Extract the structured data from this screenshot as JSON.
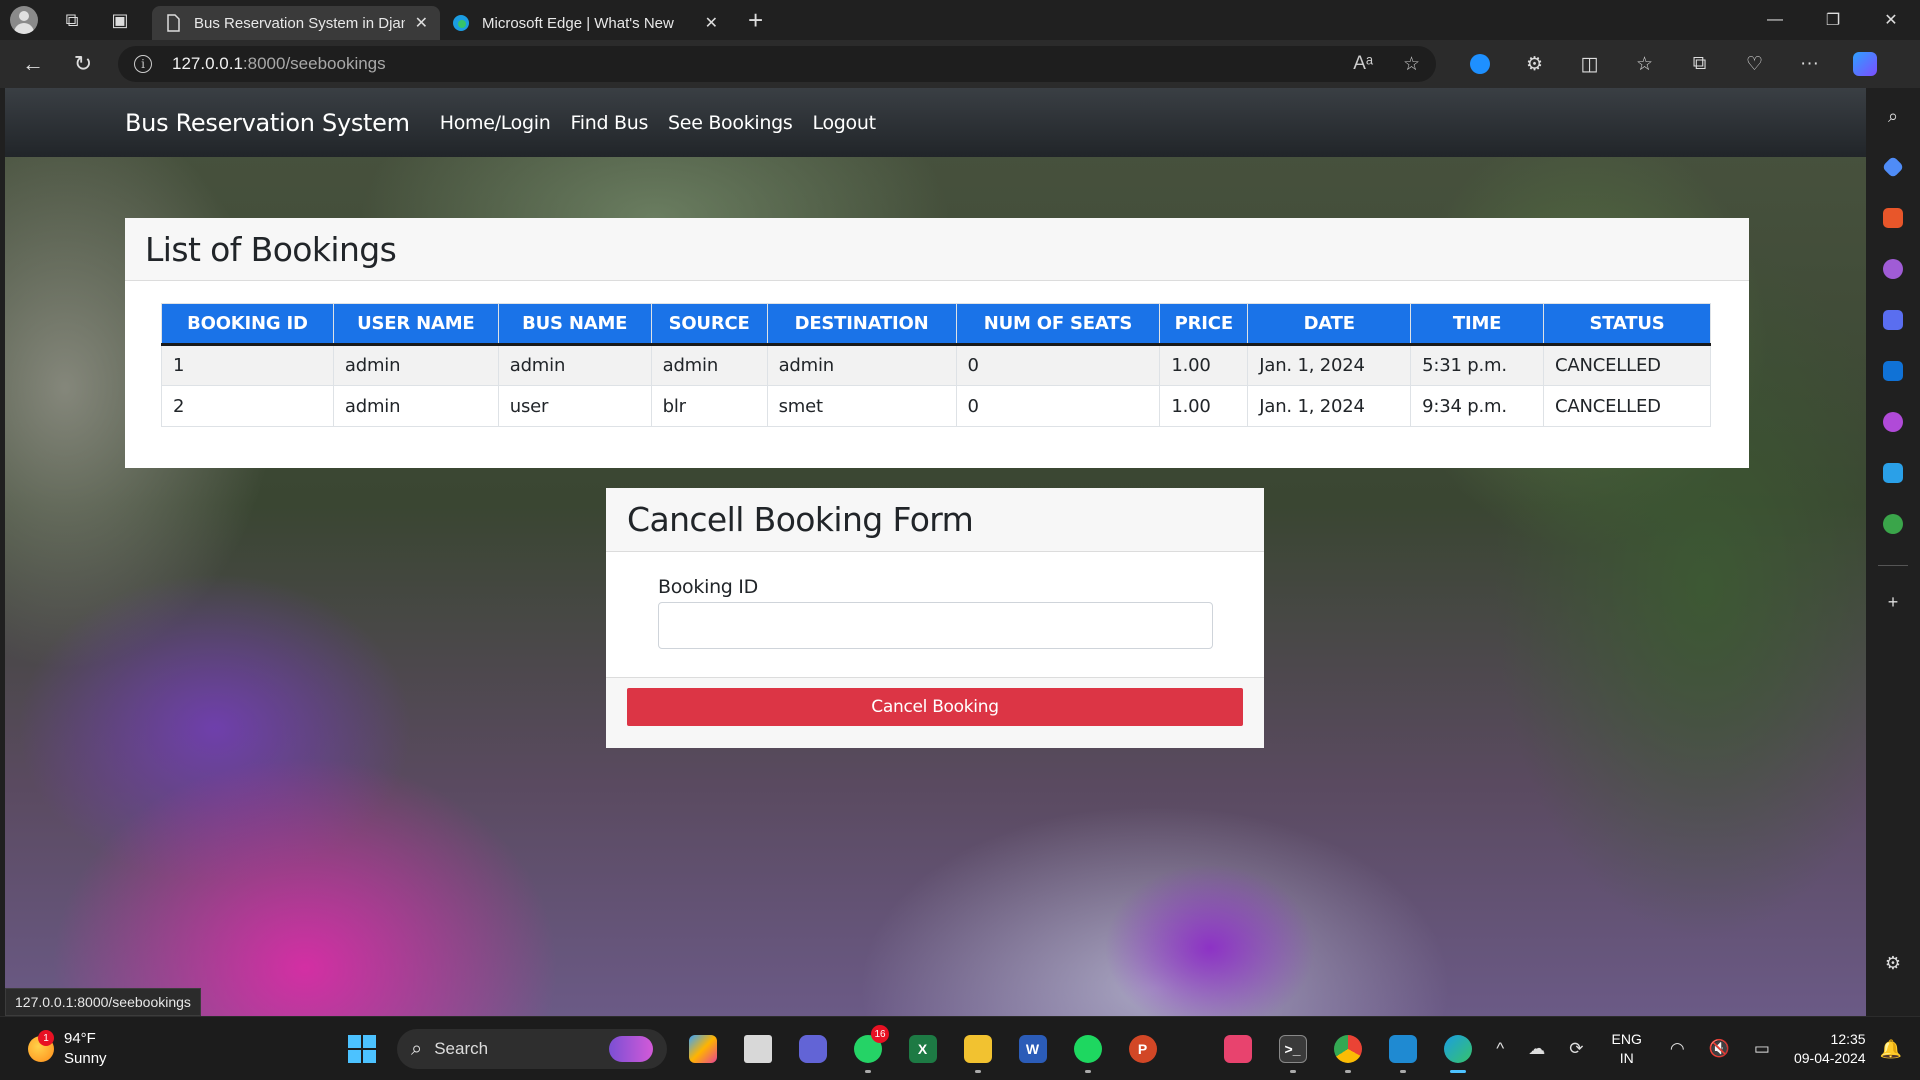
{
  "browser": {
    "tabs": [
      {
        "title": "Bus Reservation System in Djang",
        "active": true
      },
      {
        "title": "Microsoft Edge | What's New",
        "active": false
      }
    ],
    "url_host": "127.0.0.1",
    "url_path": ":8000/seebookings",
    "status_url": "127.0.0.1:8000/seebookings"
  },
  "navbar": {
    "brand": "Bus Reservation System",
    "links": [
      "Home/Login",
      "Find Bus",
      "See Bookings",
      "Logout"
    ]
  },
  "bookings": {
    "title": "List of Bookings",
    "columns": [
      "BOOKING ID",
      "USER NAME",
      "BUS NAME",
      "SOURCE",
      "DESTINATION",
      "NUM OF SEATS",
      "PRICE",
      "DATE",
      "TIME",
      "STATUS"
    ],
    "rows": [
      [
        "1",
        "admin",
        "admin",
        "admin",
        "admin",
        "0",
        "1.00",
        "Jan. 1, 2024",
        "5:31 p.m.",
        "CANCELLED"
      ],
      [
        "2",
        "admin",
        "user",
        "blr",
        "smet",
        "0",
        "1.00",
        "Jan. 1, 2024",
        "9:34 p.m.",
        "CANCELLED"
      ]
    ]
  },
  "cancel_form": {
    "title": "Cancell Booking Form",
    "field_label": "Booking ID",
    "field_value": "",
    "button_label": "Cancel Booking"
  },
  "taskbar": {
    "weather_temp": "94°F",
    "weather_desc": "Sunny",
    "weather_badge": "1",
    "search_label": "Search",
    "whatsapp_badge": "16",
    "lang_top": "ENG",
    "lang_bottom": "IN",
    "time": "12:35",
    "date": "09-04-2024"
  },
  "colors": {
    "table_header": "#1a73e8",
    "cancel_button": "#dc3545",
    "navbar": "#212529",
    "accent": "#4cc2ff"
  }
}
